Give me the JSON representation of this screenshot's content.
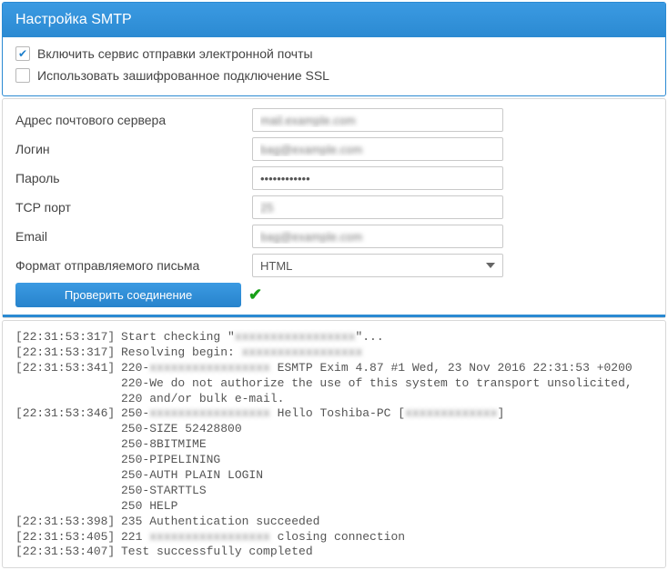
{
  "header": {
    "title": "Настройка SMTP"
  },
  "checkboxes": {
    "enable_service": {
      "label": "Включить сервис отправки электронной почты",
      "checked": true
    },
    "use_ssl": {
      "label": "Использовать зашифрованное подключение SSL",
      "checked": false
    }
  },
  "form": {
    "server": {
      "label": "Адрес почтового сервера",
      "value": "mail.example.com"
    },
    "login": {
      "label": "Логин",
      "value": "bag@example.com"
    },
    "password": {
      "label": "Пароль",
      "value": "••••••••••••"
    },
    "port": {
      "label": "TCP порт",
      "value": "25"
    },
    "email": {
      "label": "Email",
      "value": "bag@example.com"
    },
    "format": {
      "label": "Формат отправляемого письма",
      "value": "HTML"
    }
  },
  "button": {
    "test_connection": "Проверить соединение"
  },
  "log": [
    {
      "ts": "[22:31:53:317]",
      "prefix": "Start checking \"",
      "blur": "xxxxxxxxxxxxxxxxx",
      "suffix": "\"..."
    },
    {
      "ts": "[22:31:53:317]",
      "prefix": "Resolving begin: ",
      "blur": "xxxxxxxxxxxxxxxxx",
      "suffix": ""
    },
    {
      "ts": "[22:31:53:341]",
      "prefix": "220-",
      "blur": "xxxxxxxxxxxxxxxxx",
      "suffix": " ESMTP Exim 4.87 #1 Wed, 23 Nov 2016 22:31:53 +0200"
    },
    {
      "ts": "",
      "prefix": "220-We do not authorize the use of this system to transport unsolicited,"
    },
    {
      "ts": "",
      "prefix": "220 and/or bulk e-mail."
    },
    {
      "ts": "[22:31:53:346]",
      "prefix": "250-",
      "blur": "xxxxxxxxxxxxxxxxx",
      "suffix": " Hello Toshiba-PC [",
      "blur2": "xxxxxxxxxxxxx",
      "suffix2": "]"
    },
    {
      "ts": "",
      "prefix": "250-SIZE 52428800"
    },
    {
      "ts": "",
      "prefix": "250-8BITMIME"
    },
    {
      "ts": "",
      "prefix": "250-PIPELINING"
    },
    {
      "ts": "",
      "prefix": "250-AUTH PLAIN LOGIN"
    },
    {
      "ts": "",
      "prefix": "250-STARTTLS"
    },
    {
      "ts": "",
      "prefix": "250 HELP"
    },
    {
      "ts": "[22:31:53:398]",
      "prefix": "235 Authentication succeeded"
    },
    {
      "ts": "[22:31:53:405]",
      "prefix": "221 ",
      "blur": "xxxxxxxxxxxxxxxxx",
      "suffix": " closing connection"
    },
    {
      "ts": "[22:31:53:407]",
      "prefix": "Test successfully completed"
    }
  ]
}
